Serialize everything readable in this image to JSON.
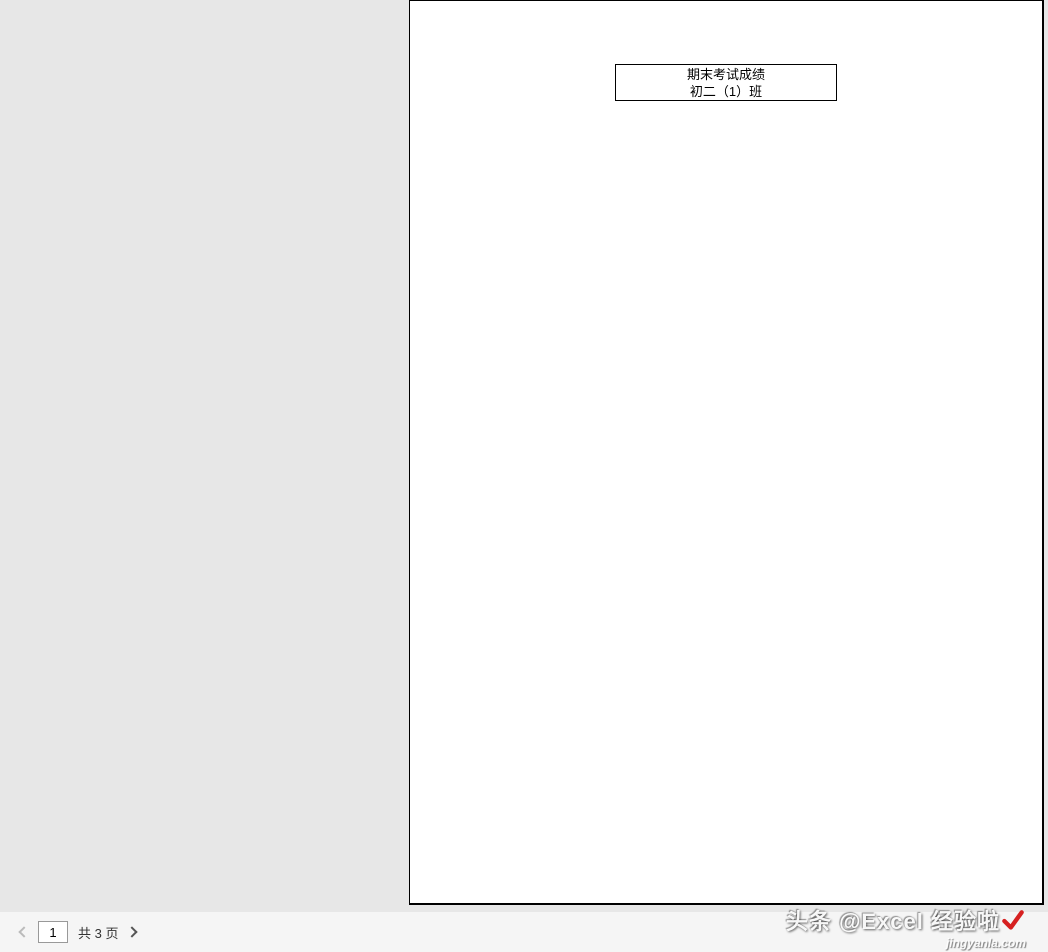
{
  "document": {
    "title_line1": "期末考试成绩",
    "title_line2": "初二（1）班"
  },
  "pager": {
    "current_page": "1",
    "total_label": "共 3 页"
  },
  "watermark": {
    "main_text": "头条 @Excel 经验啦",
    "url_text": "jingyanla.com"
  }
}
